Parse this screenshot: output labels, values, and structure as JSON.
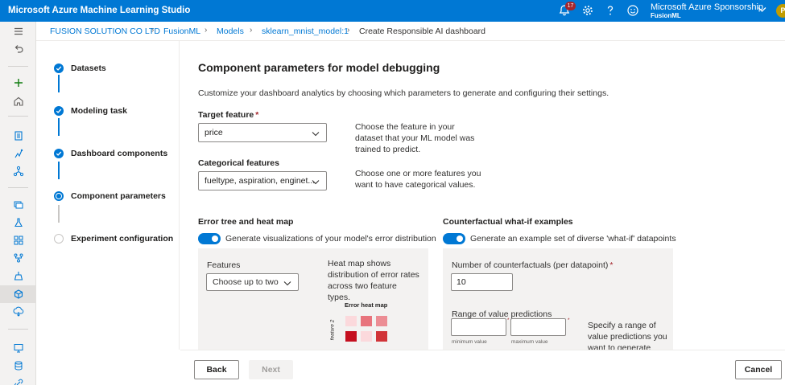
{
  "app": {
    "title": "Microsoft Azure Machine Learning Studio",
    "notification_count": "17",
    "account_name": "Microsoft Azure Sponsorship",
    "workspace": "FusionML",
    "avatar_initial": "P",
    "brand_color": "#0078d4"
  },
  "breadcrumb": [
    "FUSION SOLUTION CO LTD",
    "FusionML",
    "Models",
    "sklearn_mnist_model:1",
    "Create Responsible AI dashboard"
  ],
  "steps": [
    {
      "label": "Datasets",
      "state": "done"
    },
    {
      "label": "Modeling task",
      "state": "done"
    },
    {
      "label": "Dashboard components",
      "state": "done"
    },
    {
      "label": "Component parameters",
      "state": "current"
    },
    {
      "label": "Experiment configuration",
      "state": "pending"
    }
  ],
  "main": {
    "heading": "Component parameters for model debugging",
    "description": "Customize your dashboard analytics by choosing which parameters to generate and configuring their settings.",
    "target_feature": {
      "label": "Target feature",
      "required_mark": "*",
      "value": "price",
      "help": "Choose the feature in your dataset that your ML model was trained to predict."
    },
    "categorical_features": {
      "label": "Categorical features",
      "value": "fueltype, aspiration, enginet...",
      "help": "Choose one or more features you want to have categorical values."
    },
    "error_analysis": {
      "title": "Error tree and heat map",
      "toggle_label": "Generate visualizations of your model's error distribution",
      "toggle_on": true,
      "features_label": "Features",
      "features_placeholder": "Choose up to two",
      "heatmap_help": "Heat map shows distribution of error rates across two feature types.",
      "heatmap_title": "Error heat map",
      "heatmap_axis_label": "feature 2"
    },
    "counterfactual": {
      "title": "Counterfactual what-if examples",
      "toggle_label": "Generate an example set of diverse 'what-if' datapoints",
      "toggle_on": true,
      "count_label": "Number of counterfactuals (per datapoint)",
      "required_mark": "*",
      "count_value": "10",
      "range_label": "Range of value predictions",
      "range_required_mark": "*",
      "min_label": "minimum value",
      "max_label": "maximum value",
      "range_help": "Specify a range of value predictions you want to generate"
    }
  },
  "footer": {
    "back_label": "Back",
    "next_label": "Next",
    "cancel_label": "Cancel"
  }
}
